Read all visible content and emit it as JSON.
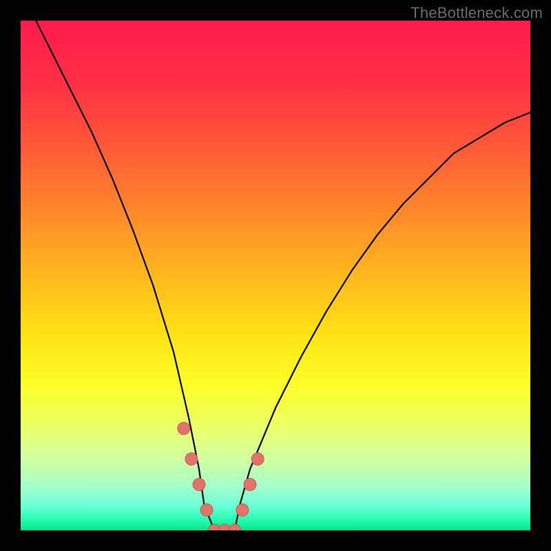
{
  "watermark": "TheBottleneck.com",
  "colors": {
    "frame_bg": "#000000",
    "curve_stroke": "#000000",
    "marker_fill": "#e0746d",
    "marker_stroke": "#c85a54",
    "gradient_stops": [
      {
        "offset": 0.0,
        "color": "#ff1a4e"
      },
      {
        "offset": 0.12,
        "color": "#ff2f45"
      },
      {
        "offset": 0.25,
        "color": "#ff5a37"
      },
      {
        "offset": 0.38,
        "color": "#ff8a2a"
      },
      {
        "offset": 0.5,
        "color": "#ffb81e"
      },
      {
        "offset": 0.62,
        "color": "#ffe414"
      },
      {
        "offset": 0.72,
        "color": "#fbff2a"
      },
      {
        "offset": 0.8,
        "color": "#eaff6a"
      },
      {
        "offset": 0.86,
        "color": "#d0ffa0"
      },
      {
        "offset": 0.91,
        "color": "#a8ffc8"
      },
      {
        "offset": 0.95,
        "color": "#70ffd8"
      },
      {
        "offset": 0.975,
        "color": "#30ffb8"
      },
      {
        "offset": 1.0,
        "color": "#00e88a"
      }
    ]
  },
  "chart_data": {
    "type": "line",
    "title": "",
    "xlabel": "",
    "ylabel": "",
    "xlim": [
      0,
      100
    ],
    "ylim": [
      0,
      100
    ],
    "grid": false,
    "legend": false,
    "annotations": [
      "TheBottleneck.com"
    ],
    "description": "V-shaped bottleneck curve. Y approaches 100 (severe bottleneck / red) at the edges and reaches 0 (optimal / green) near x≈36–42. Left branch descends steeply; right branch rises more gradually.",
    "series": [
      {
        "name": "bottleneck-curve",
        "x": [
          3,
          6,
          10,
          14,
          18,
          22,
          26,
          30,
          33,
          35,
          36,
          38,
          40,
          42,
          43,
          45,
          50,
          55,
          60,
          65,
          70,
          75,
          80,
          85,
          90,
          95,
          100
        ],
        "values": [
          100,
          94,
          86,
          78,
          69,
          59,
          48,
          35,
          22,
          12,
          5,
          0,
          0,
          0,
          5,
          12,
          24,
          34,
          43,
          51,
          58,
          64,
          69,
          74,
          77,
          80,
          82
        ]
      }
    ],
    "markers": {
      "name": "highlighted-points",
      "x": [
        32,
        33.5,
        35,
        36.5,
        38,
        40,
        42,
        43.5,
        45,
        46.5
      ],
      "values": [
        20,
        14,
        9,
        4,
        0,
        0,
        0,
        4,
        9,
        14
      ]
    }
  }
}
